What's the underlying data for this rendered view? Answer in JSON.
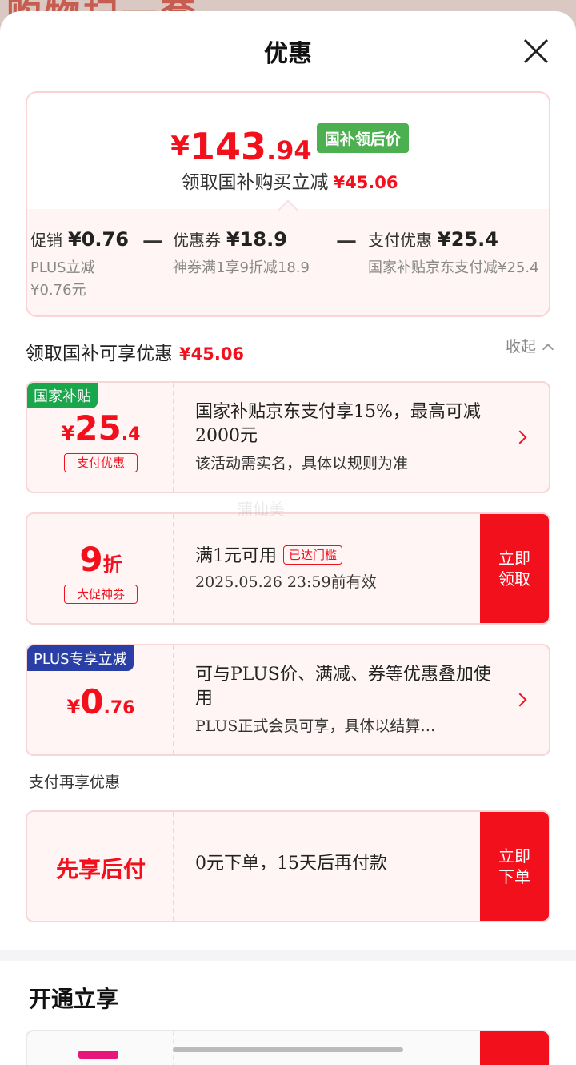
{
  "backdrop": {
    "text": "购物扫一套"
  },
  "sheet": {
    "title": "优惠",
    "close_icon": "close-icon"
  },
  "summary": {
    "price_symbol": "¥",
    "price_int": "143",
    "price_dec": ".94",
    "badge": "国补领后价",
    "sub_text": "领取国补购买立减",
    "sub_amount": "¥45.06",
    "breakdown": [
      {
        "label": "促销",
        "amount": "¥0.76",
        "desc": "PLUS立减\n¥0.76元"
      },
      {
        "label": "优惠券",
        "amount": "¥18.9",
        "desc": "神券满1享9折减18.9"
      },
      {
        "label": "支付优惠",
        "amount": "¥25.4",
        "desc": "国家补贴京东支付减¥25.4"
      }
    ],
    "minus": "—"
  },
  "section": {
    "title": "领取国补可享优惠",
    "amount": "¥45.06",
    "collapse": "收起"
  },
  "cards": [
    {
      "tag": "国家补贴",
      "symbol": "¥",
      "int": "25",
      "dec": ".4",
      "mini": "支付优惠",
      "line1": "国家补贴京东支付享15%，最高可减2000元",
      "line2": "该活动需实名，具体以规则为准"
    },
    {
      "int": "9",
      "unit": "折",
      "mini": "大促神券",
      "line1": "满1元可用",
      "threshold": "已达门槛",
      "line2": "2025.05.26 23:59前有效",
      "button": "立即领取"
    },
    {
      "tag": "PLUS专享立减",
      "symbol": "¥",
      "int": "0",
      "dec": ".76",
      "line1": "可与PLUS价、满减、券等优惠叠加使用",
      "line2": "PLUS正式会员可享，具体以结算…"
    }
  ],
  "pay": {
    "heading": "支付再享优惠",
    "label": "先享后付",
    "text": "0元下单，15天后再付款",
    "button": "立即下单"
  },
  "open": {
    "title": "开通立享"
  },
  "watermark": "蒲仙美",
  "colors": {
    "accent": "#f2101d",
    "green": "#1aa64a",
    "blue": "#2a3fa6",
    "pink": "#e8157a"
  }
}
